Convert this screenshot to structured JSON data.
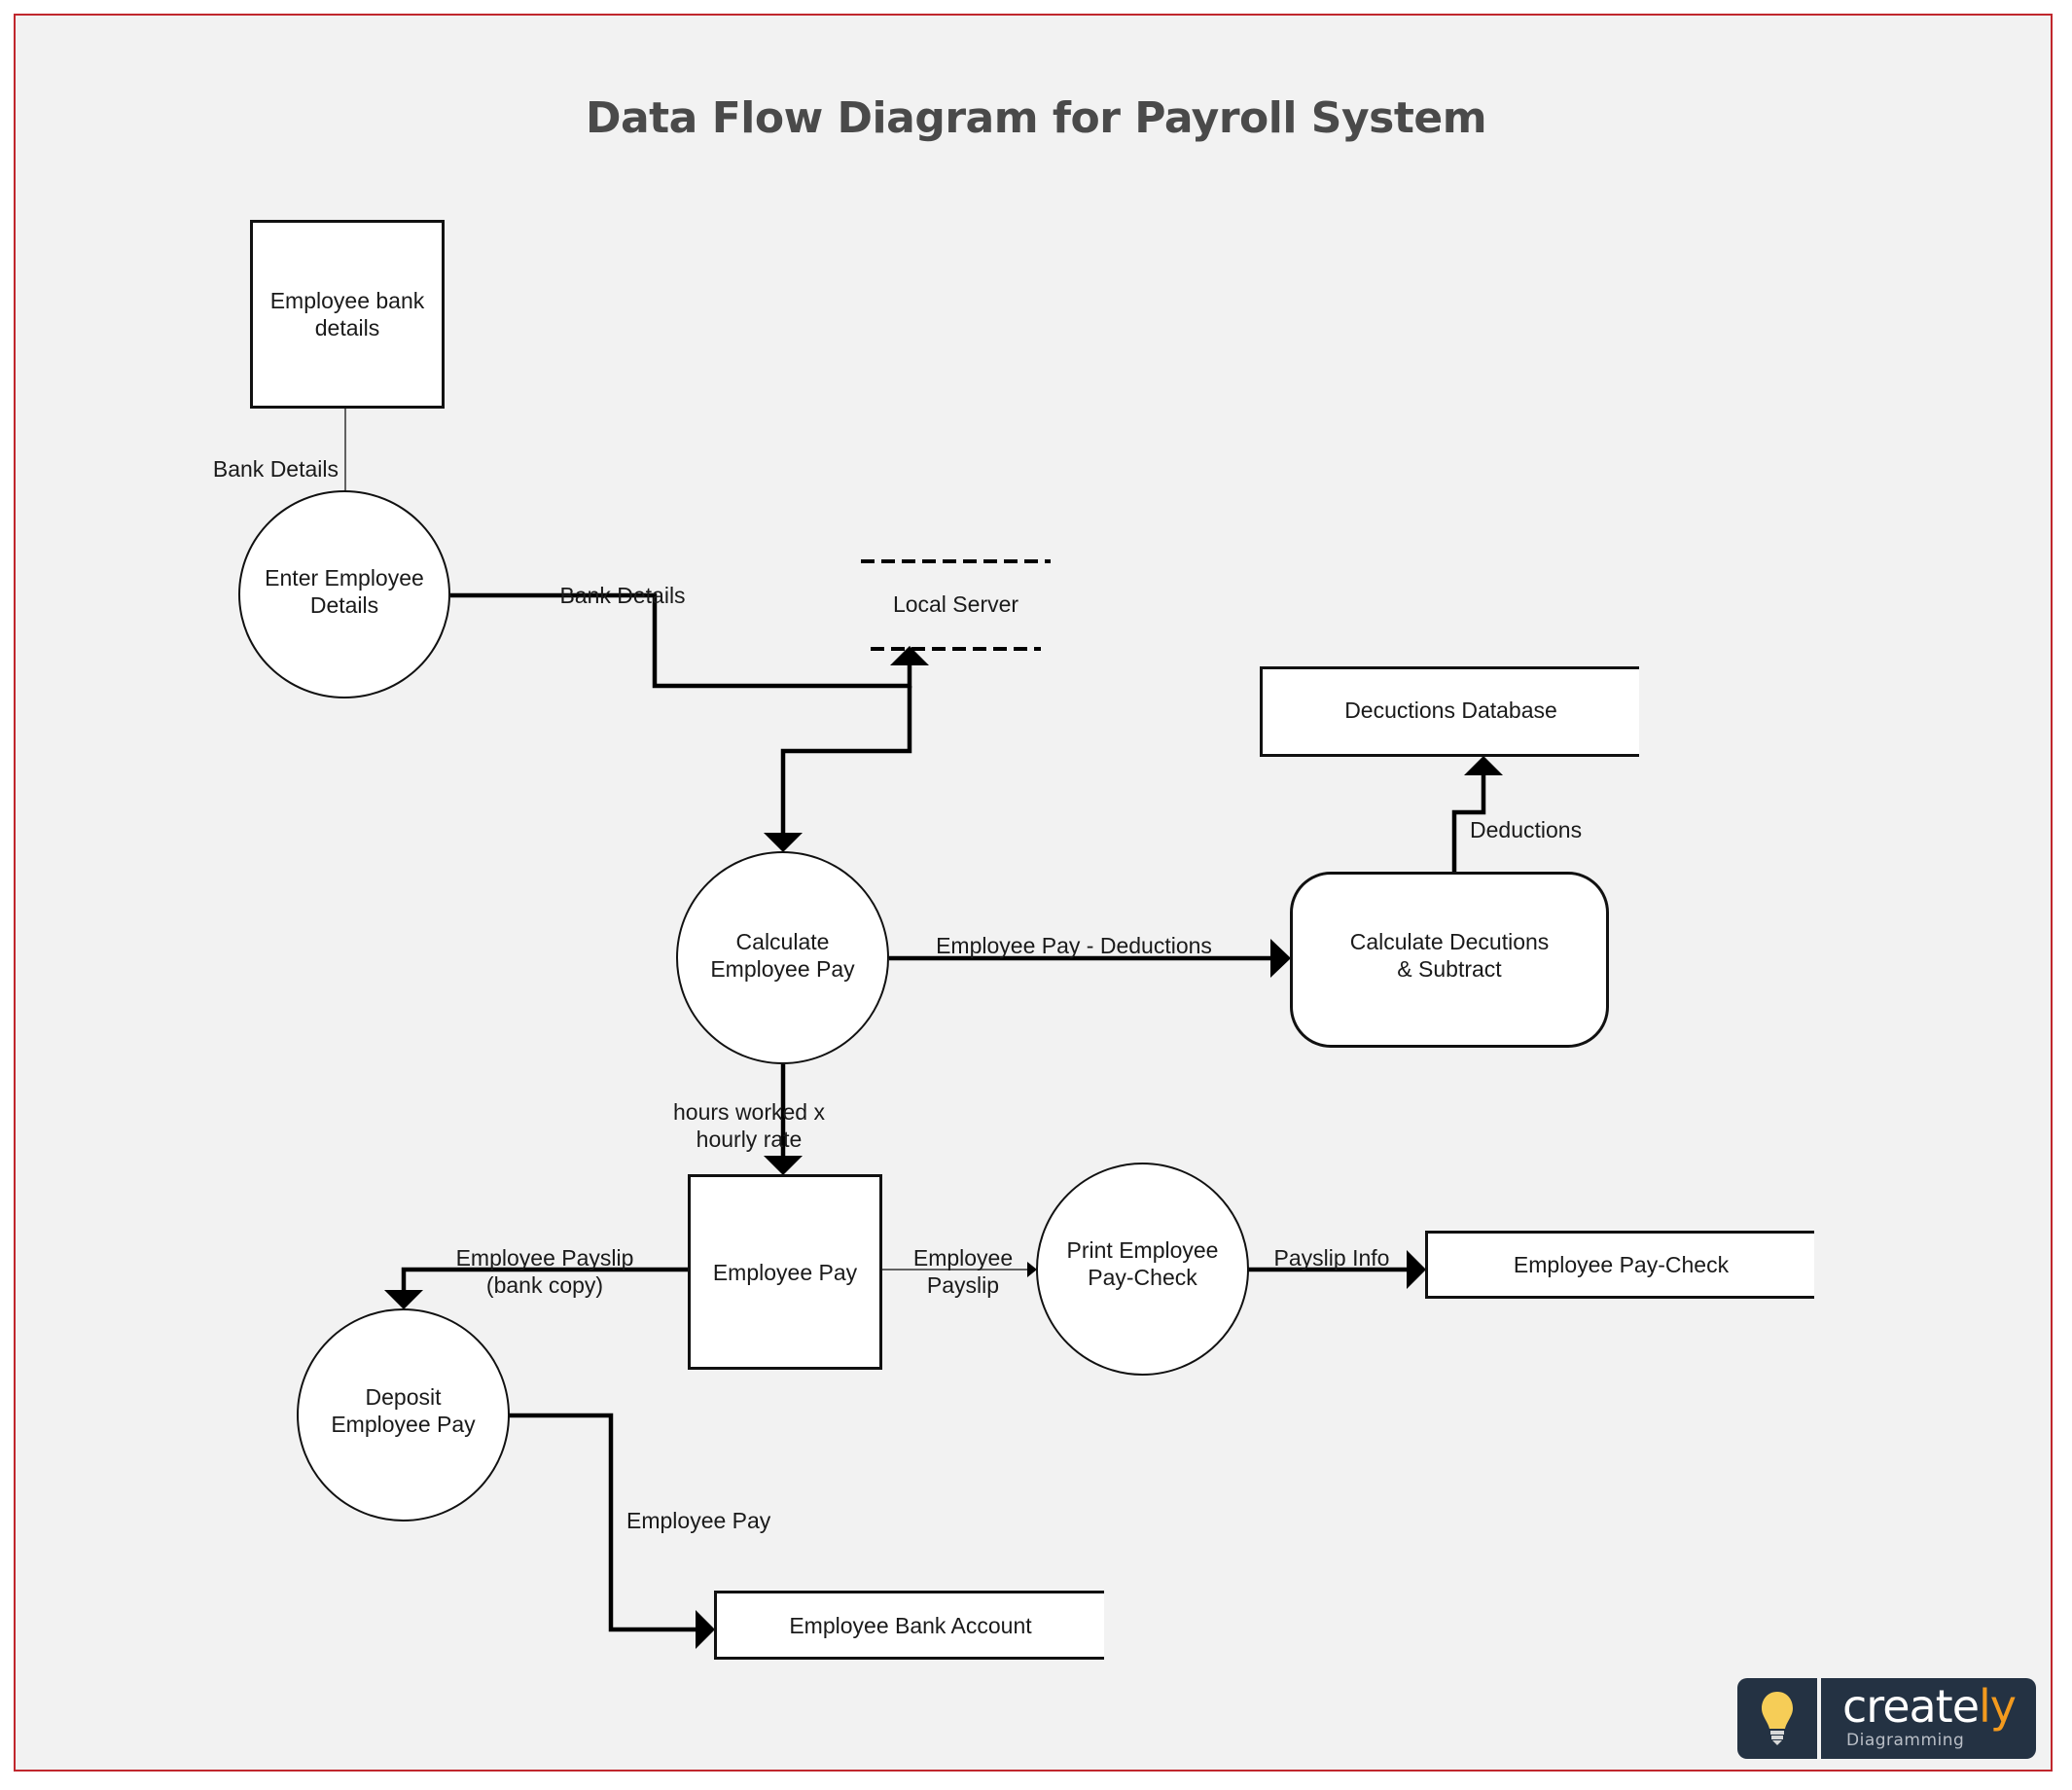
{
  "title": "Data Flow Diagram for Payroll System",
  "nodes": {
    "employee_bank_details": "Employee bank details",
    "enter_employee_details": "Enter Employee Details",
    "local_server": "Local Server",
    "deductions_database": "Decuctions Database",
    "calculate_employee_pay": "Calculate Employee Pay",
    "calculate_deductions": "Calculate Decutions & Subtract",
    "employee_pay_store": "Employee Pay",
    "print_employee_paycheck": "Print Employee Pay-Check",
    "employee_paycheck": "Employee Pay-Check",
    "deposit_employee_pay": "Deposit Employee Pay",
    "employee_bank_account": "Employee Bank Account"
  },
  "node_lines": {
    "employee_bank_details": [
      "Employee bank",
      "details"
    ],
    "enter_employee_details": [
      "Enter Employee",
      "Details"
    ],
    "calculate_employee_pay": [
      "Calculate",
      "Employee Pay"
    ],
    "calculate_deductions": [
      "Calculate Decutions",
      "& Subtract"
    ],
    "print_employee_paycheck": [
      "Print Employee",
      "Pay-Check"
    ],
    "deposit_employee_pay": [
      "Deposit",
      "Employee Pay"
    ]
  },
  "flows": {
    "bank_details_in": "Bank Details",
    "bank_details_out": "Bank Details",
    "pay_minus_deductions": "Employee Pay - Deductions",
    "deductions": "Deductions",
    "hours_worked": [
      "hours worked x",
      "hourly rate"
    ],
    "payslip_bank_copy": [
      "Employee Payslip",
      "(bank copy)"
    ],
    "employee_payslip": [
      "Employee",
      "Payslip"
    ],
    "payslip_info": "Payslip Info",
    "employee_pay": "Employee Pay"
  },
  "branding": {
    "logo_icon": "lightbulb-icon",
    "wordmark_main": "create",
    "wordmark_accent": "ly",
    "wordmark_sub": "Diagramming",
    "accent_color": "#f39a1e",
    "frame_color": "#c0272d"
  }
}
